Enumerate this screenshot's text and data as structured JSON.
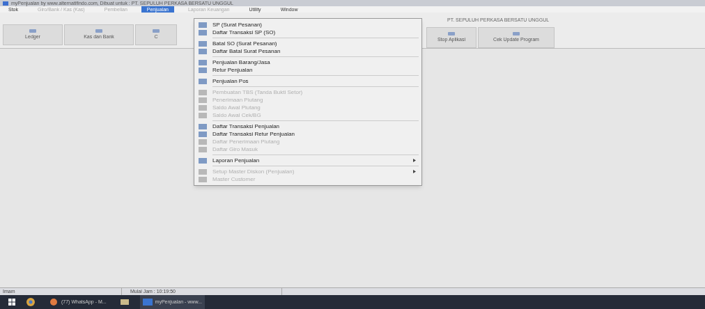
{
  "window": {
    "title": "myPenjualan by www.alternatifindo.com, Dibuat untuk : PT. SEPULUH PERKASA BERSATU UNGGUL"
  },
  "menu_bar": [
    {
      "label": "Stok",
      "selected": false,
      "disabled": false
    },
    {
      "label": "Giro/Bank / Kas (Kas)",
      "selected": false,
      "disabled": true
    },
    {
      "label": "Pembelian",
      "selected": false,
      "disabled": true
    },
    {
      "label": "Penjualan",
      "selected": true,
      "disabled": false
    },
    {
      "label": "Laporan Keuangan",
      "selected": false,
      "disabled": true
    },
    {
      "label": "Utility",
      "selected": false,
      "disabled": false
    },
    {
      "label": "Window",
      "selected": false,
      "disabled": false
    }
  ],
  "toolbar": [
    {
      "label": "Ledger"
    },
    {
      "label": "Kas dan Bank"
    },
    {
      "label": "C"
    }
  ],
  "toolbar_right": [
    {
      "label": "Stop Aplikasi"
    },
    {
      "label": "Cek Update Program"
    }
  ],
  "company": "PT. SEPULUH PERKASA BERSATU UNGGUL",
  "dropdown": [
    [
      {
        "label": "SP (Surat Pesanan)",
        "disabled": false,
        "submenu": false
      },
      {
        "label": "Daftar Transaksi SP (SO)",
        "disabled": false,
        "submenu": false
      }
    ],
    [
      {
        "label": "Batal SO (Surat Pesanan)",
        "disabled": false,
        "submenu": false
      },
      {
        "label": "Daftar Batal Surat Pesanan",
        "disabled": false,
        "submenu": false
      }
    ],
    [
      {
        "label": "Penjualan Barang/Jasa",
        "disabled": false,
        "submenu": false
      },
      {
        "label": "Retur Penjualan",
        "disabled": false,
        "submenu": false
      }
    ],
    [
      {
        "label": "Penjualan Pos",
        "disabled": false,
        "submenu": false
      }
    ],
    [
      {
        "label": "Pembuatan TBS (Tanda Bukti Setor)",
        "disabled": true,
        "submenu": false
      },
      {
        "label": "Penerimaan Piutang",
        "disabled": true,
        "submenu": false
      },
      {
        "label": "Saldo Awal Piutang",
        "disabled": true,
        "submenu": false
      },
      {
        "label": "Saldo Awal Cek/BG",
        "disabled": true,
        "submenu": false
      }
    ],
    [
      {
        "label": "Daftar Transaksi Penjualan",
        "disabled": false,
        "submenu": false
      },
      {
        "label": "Daftar Transaksi Retur Penjualan",
        "disabled": false,
        "submenu": false
      },
      {
        "label": "Daftar Penerimaan Piutang",
        "disabled": true,
        "submenu": false
      },
      {
        "label": "Daftar Giro Masuk",
        "disabled": true,
        "submenu": false
      }
    ],
    [
      {
        "label": "Laporan Penjualan",
        "disabled": false,
        "submenu": true
      }
    ],
    [
      {
        "label": "Setup Master Diskon (Penjualan)",
        "disabled": true,
        "submenu": true
      },
      {
        "label": "Master Customer",
        "disabled": true,
        "submenu": false
      }
    ]
  ],
  "status_bar": [
    "Imam",
    "Mulai Jam : 10:19:50"
  ],
  "taskbar": [
    {
      "label": "(77) WhatsApp - M..."
    },
    {
      "label": "myPenjualan - www..."
    }
  ]
}
